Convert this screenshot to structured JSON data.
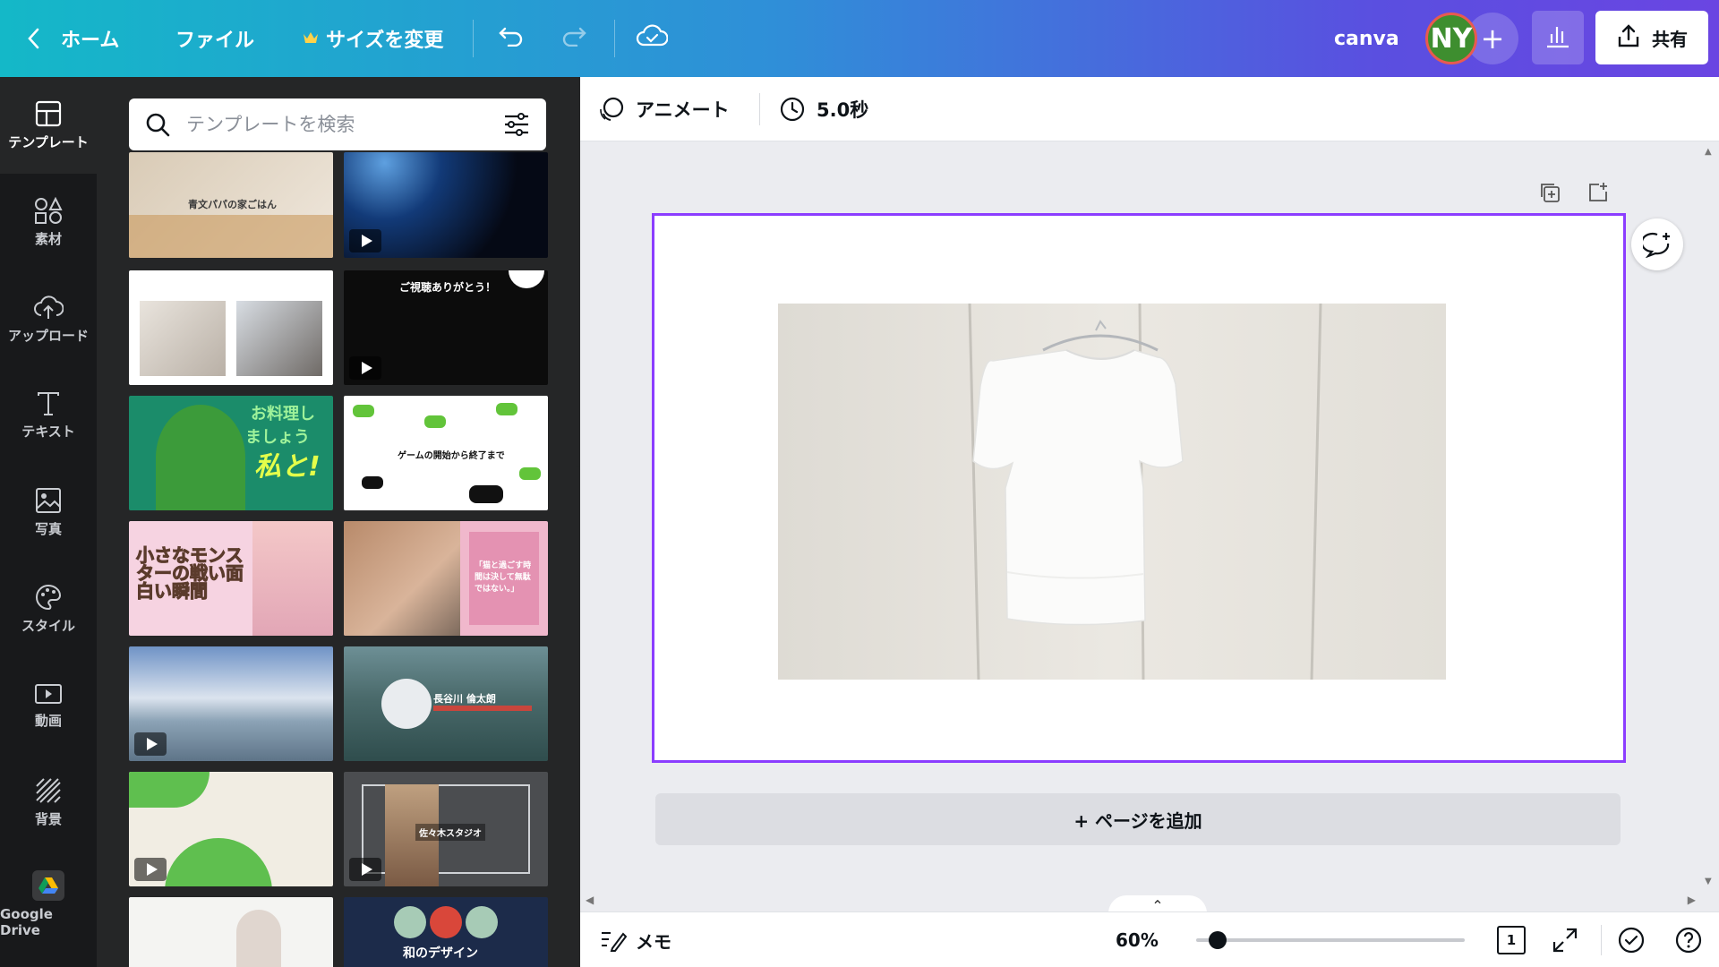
{
  "topbar": {
    "home": "ホーム",
    "file": "ファイル",
    "resize": "サイズを変更",
    "canva": "canva",
    "avatar_initials": "NY",
    "share": "共有",
    "colors": {
      "gradient_start": "#14b8c8",
      "gradient_end": "#6a45e2",
      "avatar": "#3e8e2f"
    }
  },
  "rail": {
    "items": [
      {
        "label": "テンプレート",
        "icon": "template-icon",
        "active": true
      },
      {
        "label": "素材",
        "icon": "elements-icon"
      },
      {
        "label": "アップロード",
        "icon": "upload-cloud-icon"
      },
      {
        "label": "テキスト",
        "icon": "text-icon"
      },
      {
        "label": "写真",
        "icon": "photo-icon"
      },
      {
        "label": "スタイル",
        "icon": "palette-icon"
      },
      {
        "label": "動画",
        "icon": "video-icon"
      },
      {
        "label": "背景",
        "icon": "background-icon"
      },
      {
        "label": "Google Drive",
        "icon": "google-drive-icon"
      }
    ]
  },
  "panel": {
    "search_placeholder": "テンプレートを検索",
    "thumbs": {
      "t1": "青文パパの家ごはん",
      "t4": "ご視聴ありがとう！",
      "t5a": "お料理し",
      "t5b": "ましょう",
      "t5c": "私と!",
      "t6": "ゲームの開始から終了まで",
      "t7": "小さなモンスターの戦い面白い瞬間",
      "t8": "「猫と過ごす時間は決して無駄ではない。」",
      "t10": "長谷川 倫太朗",
      "t12": "佐々木スタジオ",
      "t14": "和のデザイン"
    }
  },
  "toolbar": {
    "animate": "アニメート",
    "duration": "5.0秒"
  },
  "canvas": {
    "add_page": "+ ページを追加",
    "accent": "#8b3dff"
  },
  "bottombar": {
    "notes": "メモ",
    "zoom": "60%",
    "page_count": "1",
    "zoom_level_fraction": 0.08
  }
}
